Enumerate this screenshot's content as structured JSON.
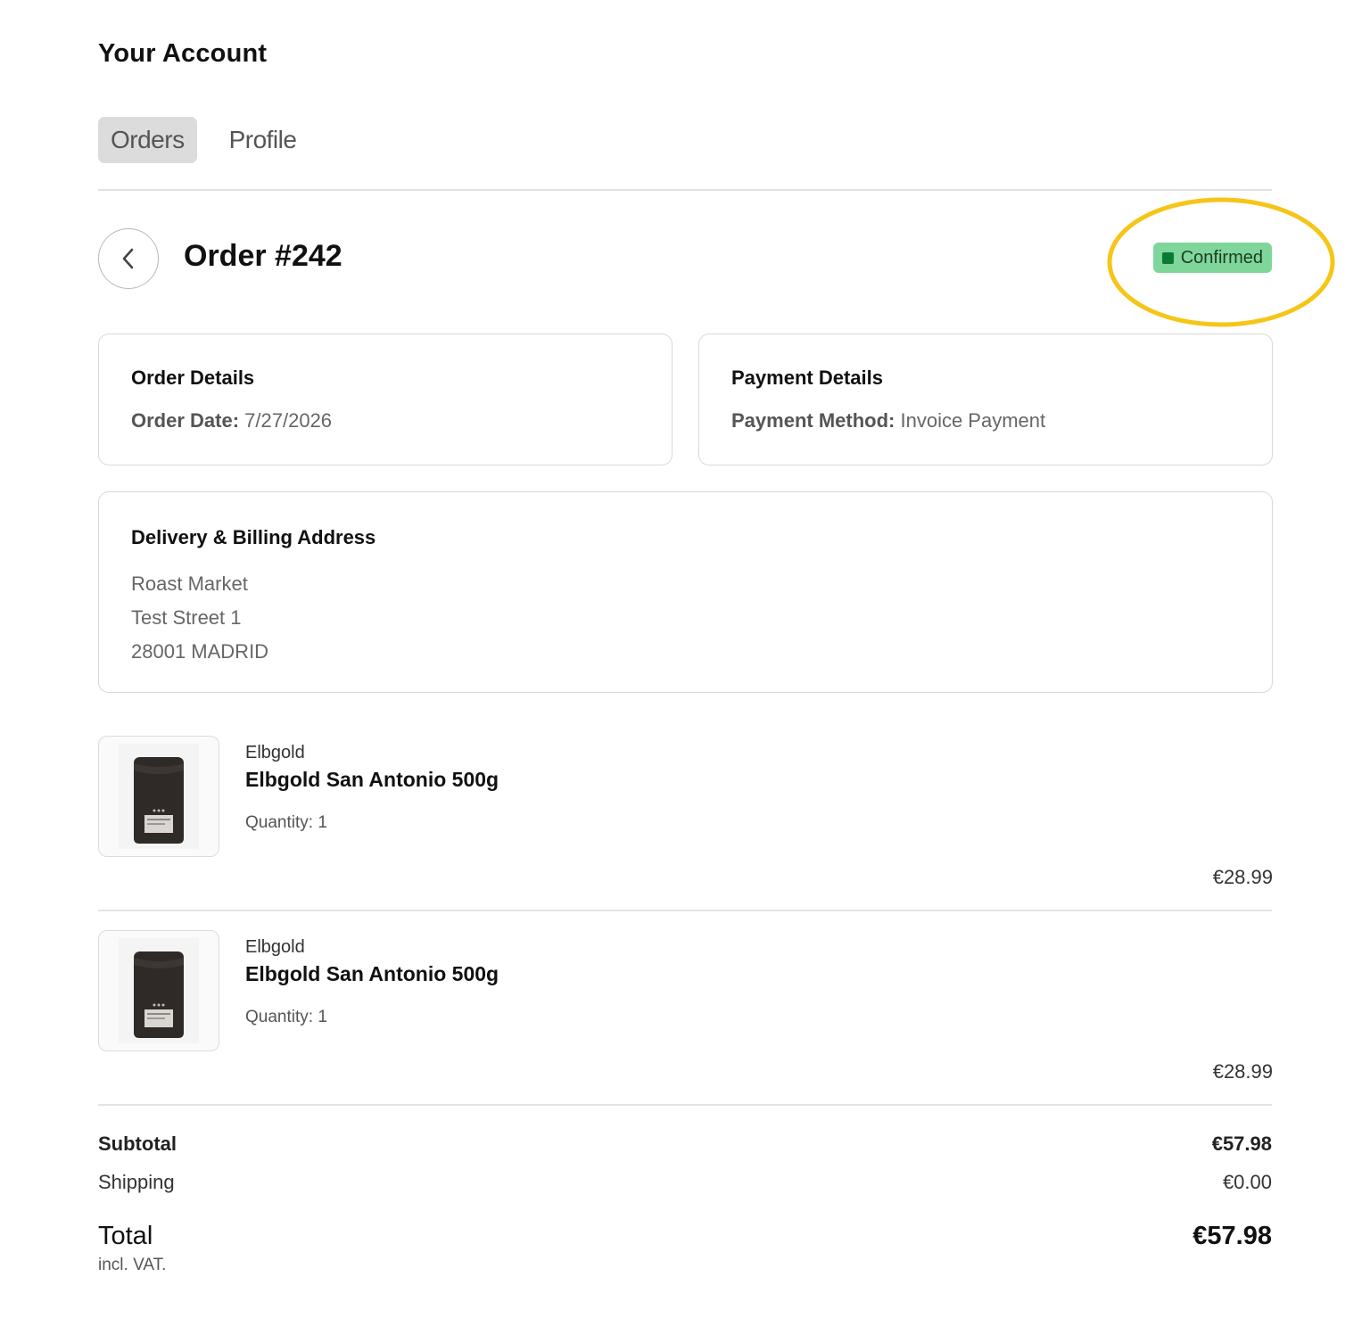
{
  "page": {
    "title": "Your Account"
  },
  "tabs": [
    {
      "label": "Orders",
      "active": true
    },
    {
      "label": "Profile",
      "active": false
    }
  ],
  "order": {
    "title": "Order #242",
    "status": "Confirmed",
    "status_color": "#7fd69b"
  },
  "order_details": {
    "title": "Order Details",
    "date_label": "Order Date:",
    "date_value": "7/27/2026"
  },
  "payment_details": {
    "title": "Payment Details",
    "method_label": "Payment Method:",
    "method_value": "Invoice Payment"
  },
  "address": {
    "title": "Delivery & Billing Address",
    "lines": [
      "Roast Market",
      "Test Street 1",
      "28001 MADRID"
    ]
  },
  "items": [
    {
      "brand": "Elbgold",
      "name": "Elbgold San Antonio 500g",
      "quantity": "Quantity: 1",
      "price": "€28.99"
    },
    {
      "brand": "Elbgold",
      "name": "Elbgold San Antonio 500g",
      "quantity": "Quantity: 1",
      "price": "€28.99"
    }
  ],
  "summary": {
    "subtotal_label": "Subtotal",
    "subtotal_value": "€57.98",
    "shipping_label": "Shipping",
    "shipping_value": "€0.00",
    "total_label": "Total",
    "total_value": "€57.98",
    "vat_note": "incl. VAT."
  },
  "annotation": {
    "highlight_color": "#f5c518"
  }
}
